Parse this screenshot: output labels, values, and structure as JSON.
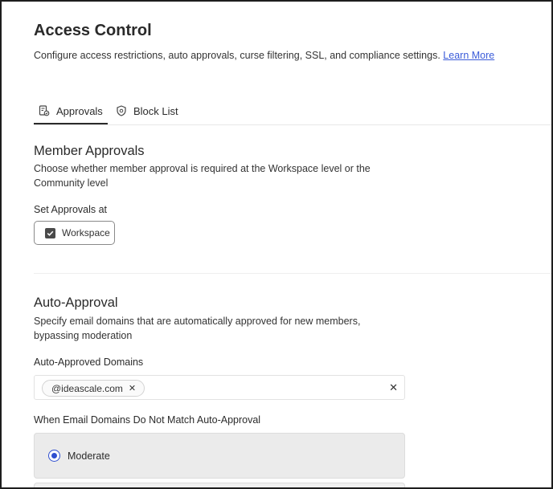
{
  "header": {
    "title": "Access Control",
    "description": "Configure access restrictions, auto approvals, curse filtering, SSL, and compliance settings.",
    "learn_more": "Learn More"
  },
  "tabs": [
    {
      "label": "Approvals",
      "icon": "approvals-doc-icon",
      "active": true
    },
    {
      "label": "Block List",
      "icon": "shield-icon",
      "active": false
    }
  ],
  "member_approvals": {
    "title": "Member Approvals",
    "description": "Choose whether member approval is required at the Workspace level or the Community level",
    "set_label": "Set Approvals at",
    "option": {
      "label": "Workspace",
      "checked": true
    }
  },
  "auto_approval": {
    "title": "Auto-Approval",
    "description": "Specify email domains that are automatically approved for new members, bypassing moderation",
    "domains_label": "Auto-Approved Domains",
    "domains": [
      "@ideascale.com"
    ],
    "no_match_label": "When Email Domains Do Not Match Auto-Approval",
    "options": [
      {
        "label": "Moderate",
        "selected": true
      }
    ]
  },
  "colors": {
    "accent": "#2f4fd0",
    "link": "#3a5bd9"
  }
}
